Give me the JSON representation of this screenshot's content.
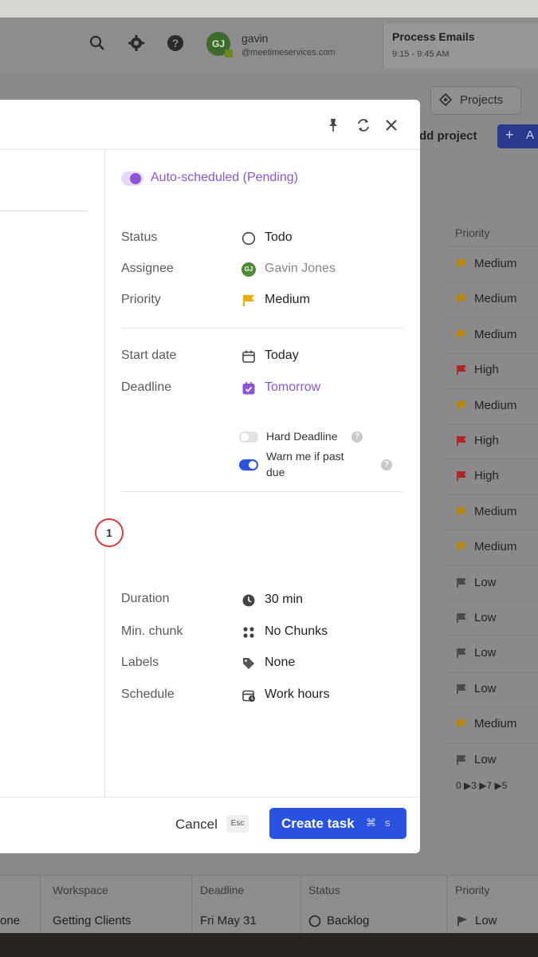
{
  "header": {
    "user_initials": "GJ",
    "user_name": "gavin",
    "user_email": "@meetimeservices.com",
    "event_title": "Process Emails",
    "event_time": "9:15 - 9:45 AM"
  },
  "toolbar": {
    "projects_label": "Projects",
    "add_project_label": "dd project",
    "add_button_label": "A"
  },
  "background_table": {
    "header": "Priority",
    "rows": [
      {
        "priority": "Medium",
        "color": "#b8860b"
      },
      {
        "priority": "Medium",
        "color": "#b8860b"
      },
      {
        "priority": "Medium",
        "color": "#b8860b"
      },
      {
        "priority": "High",
        "color": "#b22222"
      },
      {
        "priority": "Medium",
        "color": "#b8860b"
      },
      {
        "priority": "High",
        "color": "#b22222"
      },
      {
        "priority": "High",
        "color": "#b22222"
      },
      {
        "priority": "Medium",
        "color": "#b8860b"
      },
      {
        "priority": "Medium",
        "color": "#b8860b"
      },
      {
        "priority": "Low",
        "color": "#4a4a4a"
      },
      {
        "priority": "Low",
        "color": "#4a4a4a"
      },
      {
        "priority": "Low",
        "color": "#4a4a4a"
      },
      {
        "priority": "Low",
        "color": "#4a4a4a"
      },
      {
        "priority": "Medium",
        "color": "#b8860b"
      },
      {
        "priority": "Low",
        "color": "#4a4a4a"
      }
    ],
    "summary": "0 ▶3 ▶7 ▶5"
  },
  "bottom_row": {
    "headers": [
      "Workspace",
      "Deadline",
      "Status",
      "Priority"
    ],
    "cells": [
      "one",
      "Getting Clients",
      "Fri May 31",
      "Backlog",
      "Low"
    ]
  },
  "modal": {
    "auto_scheduled_label": "Auto-scheduled (Pending)",
    "fields": {
      "status": {
        "label": "Status",
        "value": "Todo"
      },
      "assignee": {
        "label": "Assignee",
        "value": "Gavin Jones",
        "initials": "GJ"
      },
      "priority": {
        "label": "Priority",
        "value": "Medium"
      },
      "start_date": {
        "label": "Start date",
        "value": "Today"
      },
      "deadline": {
        "label": "Deadline",
        "value": "Tomorrow"
      },
      "hard_deadline": {
        "label": "Hard Deadline",
        "enabled": false
      },
      "warn_past_due": {
        "label_line1": "Warn me if past",
        "label_line2": "due",
        "enabled": true
      },
      "duration": {
        "label": "Duration",
        "value": "30 min"
      },
      "min_chunk": {
        "label": "Min. chunk",
        "value": "No Chunks"
      },
      "labels": {
        "label": "Labels",
        "value": "None"
      },
      "schedule": {
        "label": "Schedule",
        "value": "Work hours"
      }
    },
    "footer": {
      "cancel_label": "Cancel",
      "cancel_shortcut": "Esc",
      "create_label": "Create task",
      "create_shortcut_1": "⌘",
      "create_shortcut_2": "s"
    },
    "step_badge": "1"
  },
  "colors": {
    "accent_purple": "#8b55d6",
    "primary_blue": "#2a52e0",
    "medium_flag": "#f2a900"
  }
}
